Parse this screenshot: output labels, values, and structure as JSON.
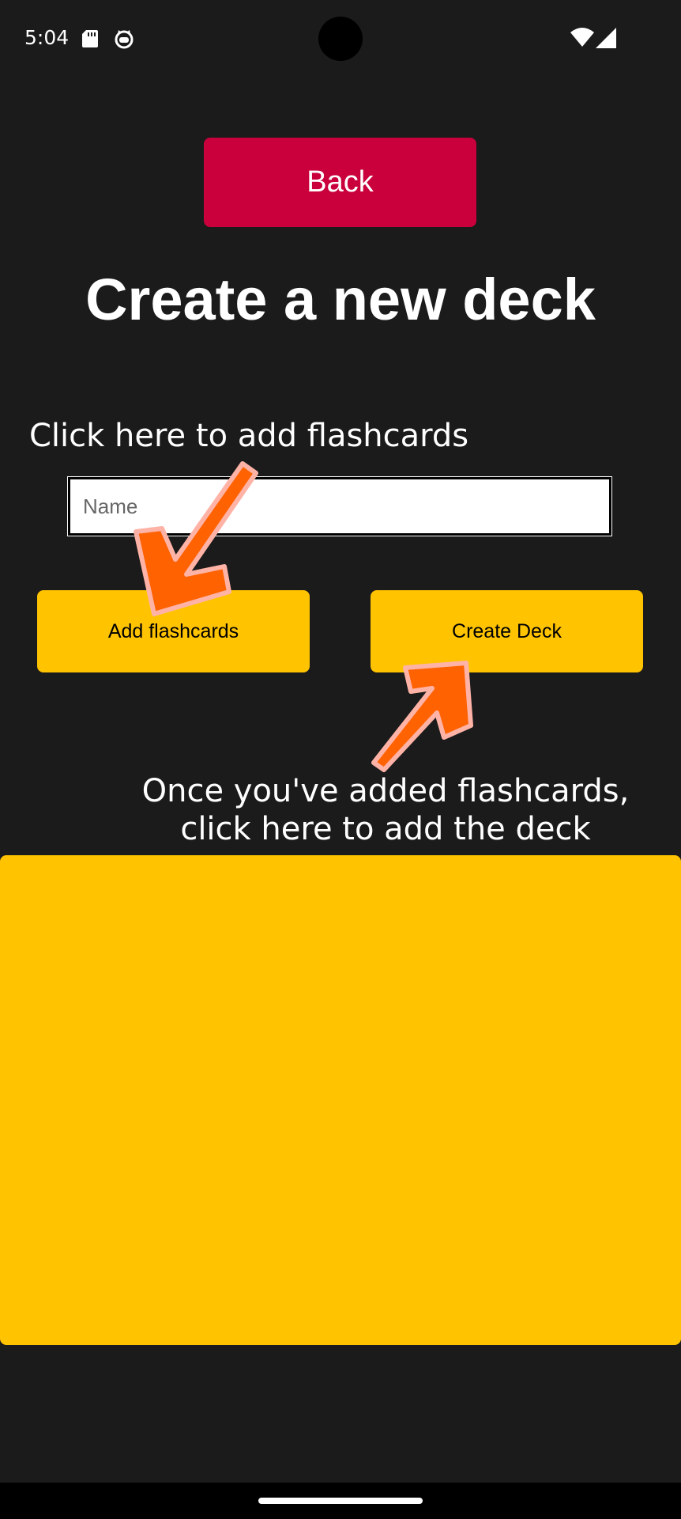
{
  "status_bar": {
    "time": "5:04",
    "left_icons": [
      "sd-card-icon",
      "cat-face-icon"
    ],
    "right_icons": [
      "wifi-icon",
      "signal-icon"
    ]
  },
  "back_button": {
    "label": "Back"
  },
  "page": {
    "title": "Create a new deck"
  },
  "annotations": {
    "add_hint": "Click here to add flashcards",
    "create_hint_line1": "Once you've added flashcards,",
    "create_hint_line2": "click here to add the deck"
  },
  "name_field": {
    "placeholder": "Name",
    "value": ""
  },
  "buttons": {
    "add_flashcards": "Add flashcards",
    "create_deck": "Create Deck"
  },
  "colors": {
    "background": "#1b1b1b",
    "back_button": "#c9003c",
    "accent_yellow": "#ffc300",
    "arrow_orange": "#ff6200",
    "arrow_outline": "#ffb3a6"
  }
}
